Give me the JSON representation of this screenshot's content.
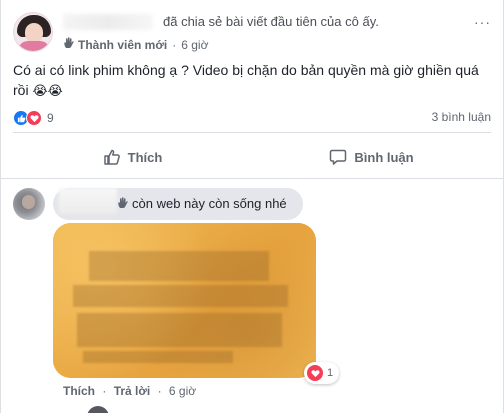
{
  "post": {
    "headline": "đã chia sẻ bài viết đầu tiên của cô ấy.",
    "role_badge": "Thành viên mới",
    "time": "6 giờ",
    "more": "···",
    "text": "Có ai có link phim không ạ ? Video bị chặn do bản quyền mà giờ ghiền quá rồi",
    "text_emoji": "😭😭",
    "reactions_count": "9",
    "comments_count": "3 bình luận"
  },
  "actions": {
    "like": "Thích",
    "comment": "Bình luận"
  },
  "comment": {
    "text": "còn web này còn sống nhé",
    "like": "Thích",
    "reply": "Trả lời",
    "time": "6 giờ",
    "love_count": "1"
  },
  "colors": {
    "like_blue": "#1877f2",
    "love_red": "#f33e58",
    "photo_orange": "#e8ac45"
  }
}
